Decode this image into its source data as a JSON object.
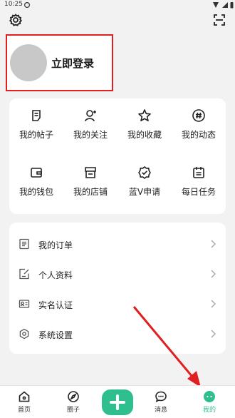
{
  "status_bar": {
    "time": "10:25"
  },
  "top_bar": {
    "settings_icon": "gear-icon",
    "scan_icon": "scan-icon"
  },
  "profile": {
    "login_label": "立即登录"
  },
  "shortcuts": [
    {
      "label": "我的帖子",
      "icon": "post-icon"
    },
    {
      "label": "我的关注",
      "icon": "follow-icon"
    },
    {
      "label": "我的收藏",
      "icon": "star-icon"
    },
    {
      "label": "我的动态",
      "icon": "hashtag-icon"
    },
    {
      "label": "我的钱包",
      "icon": "wallet-icon"
    },
    {
      "label": "我的店铺",
      "icon": "store-icon"
    },
    {
      "label": "蓝V申请",
      "icon": "badge-icon"
    },
    {
      "label": "每日任务",
      "icon": "calendar-icon"
    }
  ],
  "menu": [
    {
      "label": "我的订单",
      "icon": "order-icon"
    },
    {
      "label": "个人资料",
      "icon": "profile-edit-icon"
    },
    {
      "label": "实名认证",
      "icon": "id-card-icon"
    },
    {
      "label": "系统设置",
      "icon": "settings-hex-icon"
    }
  ],
  "tabs": [
    {
      "label": "首页",
      "icon": "home-icon"
    },
    {
      "label": "圈子",
      "icon": "compass-icon"
    },
    {
      "label": "",
      "icon": "plus-icon"
    },
    {
      "label": "消息",
      "icon": "message-icon"
    },
    {
      "label": "我的",
      "icon": "me-icon",
      "active": true
    }
  ],
  "colors": {
    "accent": "#2fbf8f",
    "highlight": "#e02020"
  }
}
